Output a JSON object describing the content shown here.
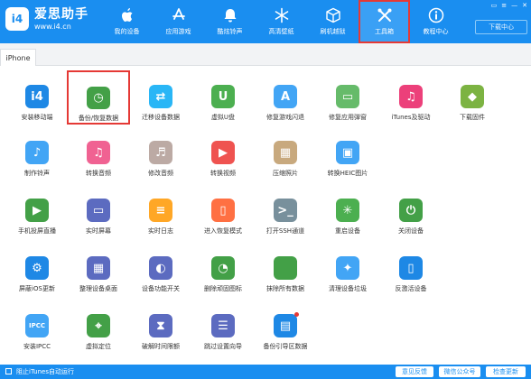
{
  "header": {
    "logo_badge": "i4",
    "logo_name": "爱思助手",
    "logo_url": "www.i4.cn",
    "download_label": "下载中心",
    "nav": [
      {
        "label": "我的设备",
        "icon": "apple-icon"
      },
      {
        "label": "应用游戏",
        "icon": "appstore-icon"
      },
      {
        "label": "酷炫铃声",
        "icon": "bell-icon"
      },
      {
        "label": "高清壁纸",
        "icon": "snowflake-icon"
      },
      {
        "label": "刷机越狱",
        "icon": "box-icon"
      },
      {
        "label": "工具箱",
        "icon": "tools-icon"
      },
      {
        "label": "教程中心",
        "icon": "info-icon"
      }
    ]
  },
  "tabs": [
    {
      "label": "iPhone"
    }
  ],
  "tools": [
    {
      "label": "安装移动端",
      "icon": "i4-app-icon",
      "color": "#1e88e5",
      "glyph": "i4"
    },
    {
      "label": "备份/恢复数据",
      "icon": "backup-clock-icon",
      "color": "#43a047",
      "glyph": "◷"
    },
    {
      "label": "迁移设备数据",
      "icon": "migrate-phone-icon",
      "color": "#29b6f6",
      "glyph": "⇄"
    },
    {
      "label": "虚拟U盘",
      "icon": "usb-drive-icon",
      "color": "#4caf50",
      "glyph": "U"
    },
    {
      "label": "修复游戏闪退",
      "icon": "appstore-repair-icon",
      "color": "#42a5f5",
      "glyph": "A"
    },
    {
      "label": "修复应用弹窗",
      "icon": "app-popup-icon",
      "color": "#66bb6a",
      "glyph": "▭"
    },
    {
      "label": "iTunes及驱动",
      "icon": "itunes-icon",
      "color": "#ec407a",
      "glyph": "♫"
    },
    {
      "label": "下载固件",
      "icon": "firmware-cube-icon",
      "color": "#7cb342",
      "glyph": "◆"
    },
    {
      "label": "制作铃声",
      "icon": "ringtone-bell-icon",
      "color": "#42a5f5",
      "glyph": "♪"
    },
    {
      "label": "转换音频",
      "icon": "audio-convert-icon",
      "color": "#f06292",
      "glyph": "♫"
    },
    {
      "label": "修改音频",
      "icon": "audio-edit-icon",
      "color": "#bcaaa4",
      "glyph": "♬"
    },
    {
      "label": "转换视频",
      "icon": "video-convert-icon",
      "color": "#ef5350",
      "glyph": "▶"
    },
    {
      "label": "压缩照片",
      "icon": "photo-compress-icon",
      "color": "#c8a97e",
      "glyph": "▦"
    },
    {
      "label": "转换HEIC图片",
      "icon": "heic-photo-icon",
      "color": "#42a5f5",
      "glyph": "▣"
    },
    {
      "label": "手机投屏直播",
      "icon": "screen-cast-icon",
      "color": "#43a047",
      "glyph": "▶"
    },
    {
      "label": "实时屏幕",
      "icon": "live-screen-icon",
      "color": "#5c6bc0",
      "glyph": "▭"
    },
    {
      "label": "实时日志",
      "icon": "realtime-log-icon",
      "color": "#ffa726",
      "glyph": "≡"
    },
    {
      "label": "进入恢复模式",
      "icon": "recovery-mode-icon",
      "color": "#ff7043",
      "glyph": "▯"
    },
    {
      "label": "打开SSH通道",
      "icon": "ssh-terminal-icon",
      "color": "#78909c",
      "glyph": ">_"
    },
    {
      "label": "重启设备",
      "icon": "restart-spinner-icon",
      "color": "#4caf50",
      "glyph": "✳"
    },
    {
      "label": "关闭设备",
      "icon": "power-icon",
      "color": "#43a047",
      "glyph": "⏻"
    },
    {
      "label": "屏蔽iOS更新",
      "icon": "block-update-gear-icon",
      "color": "#1e88e5",
      "glyph": "⚙"
    },
    {
      "label": "整理设备桌面",
      "icon": "desktop-organize-icon",
      "color": "#5c6bc0",
      "glyph": "▦"
    },
    {
      "label": "设备功能开关",
      "icon": "feature-toggle-icon",
      "color": "#5c6bc0",
      "glyph": "◐"
    },
    {
      "label": "删除顽固图标",
      "icon": "delete-icon-pie-icon",
      "color": "#43a047",
      "glyph": "◔"
    },
    {
      "label": "抹除所有数据",
      "icon": "erase-apple-icon",
      "color": "#43a047",
      "glyph": ""
    },
    {
      "label": "清理设备垃圾",
      "icon": "clean-broom-icon",
      "color": "#42a5f5",
      "glyph": "✦"
    },
    {
      "label": "反激活设备",
      "icon": "deactivate-device-icon",
      "color": "#1e88e5",
      "glyph": "▯"
    },
    {
      "label": "安装IPCC",
      "icon": "ipcc-icon",
      "color": "#42a5f5",
      "glyph": "IPCC"
    },
    {
      "label": "虚拟定位",
      "icon": "location-pin-icon",
      "color": "#43a047",
      "glyph": "⌖"
    },
    {
      "label": "破解时间限额",
      "icon": "hourglass-icon",
      "color": "#5c6bc0",
      "glyph": "⧗"
    },
    {
      "label": "跳过设置向导",
      "icon": "skip-setup-icon",
      "color": "#5c6bc0",
      "glyph": "☰"
    },
    {
      "label": "备份引导区数据",
      "icon": "boot-backup-icon",
      "color": "#1e88e5",
      "glyph": "▤"
    }
  ],
  "footer": {
    "checkbox_label": "阻止iTunes自动运行",
    "wechat_label": "微信公众号",
    "feedback_label": "意见反馈",
    "update_label": "检查更新"
  }
}
